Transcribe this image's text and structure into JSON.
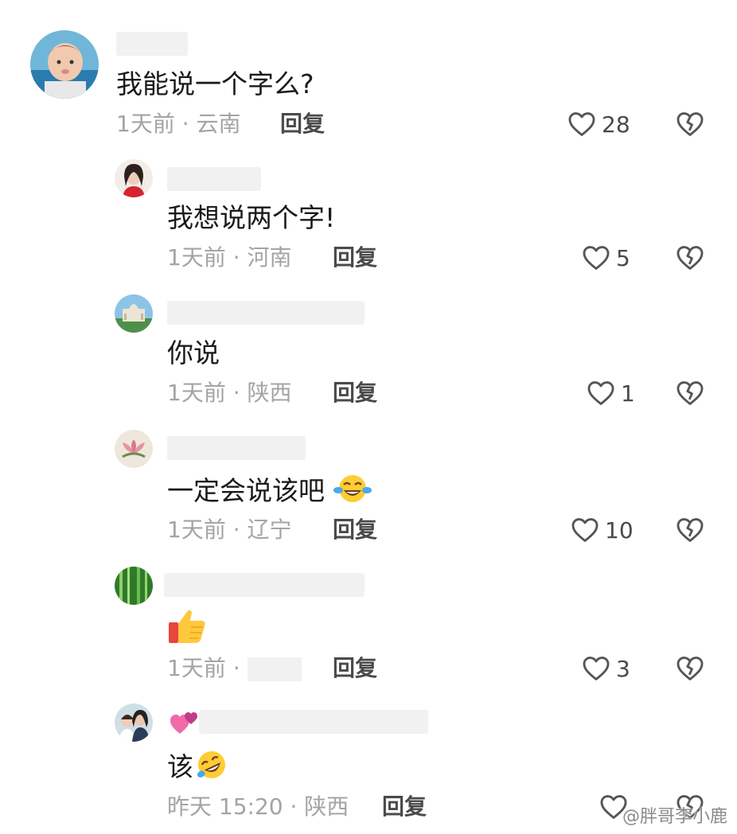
{
  "comments": [
    {
      "text": "我能说一个字么?",
      "time": "1天前 · 云南",
      "reply_label": "回复",
      "likes": "28"
    },
    {
      "text": "我想说两个字!",
      "time": "1天前 · 河南",
      "reply_label": "回复",
      "likes": "5"
    },
    {
      "text": "你说",
      "time": "1天前 · 陕西",
      "reply_label": "回复",
      "likes": "1"
    },
    {
      "text": "一定会说该吧",
      "emoji": "tears-of-joy-emoji",
      "time": "1天前 · 辽宁",
      "reply_label": "回复",
      "likes": "10"
    },
    {
      "emoji": "thumbs-up-emoji",
      "time": "1天前 ·",
      "reply_label": "回复",
      "likes": "3"
    },
    {
      "text": "该",
      "emoji": "rolling-laughing-emoji",
      "name_badge": "two-hearts-emoji",
      "time": "昨天 15:20 · 陕西",
      "reply_label": "回复",
      "likes": ""
    }
  ],
  "watermark": "@胖哥李小鹿",
  "colors": {
    "text": "#1a1a1a",
    "meta": "#a4a4a4",
    "reply": "#4a4a4a",
    "icon": "#555555"
  }
}
